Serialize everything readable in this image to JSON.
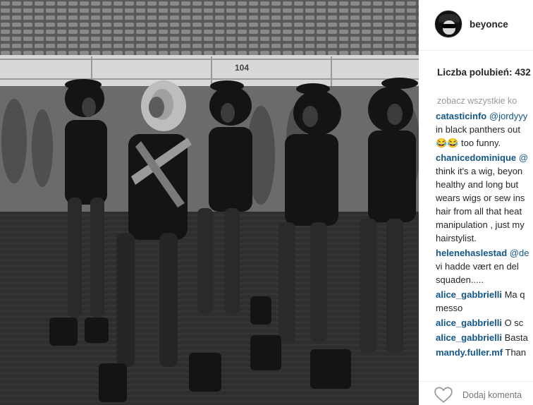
{
  "post": {
    "username": "beyonce",
    "likes_label": "Liczba polubień: 432",
    "see_all_label": "zobacz wszystkie ko",
    "add_comment_placeholder": "Dodaj komenta"
  },
  "photo": {
    "section_sign": "104"
  },
  "comments": [
    {
      "user": "catasticinfo",
      "lines": [
        "@jordyyy",
        "in black panthers out",
        "😂😂 too funny."
      ]
    },
    {
      "user": "chanicedominique",
      "lines": [
        "@",
        "think it's a wig, beyon",
        "healthy and long but",
        "wears wigs or sew ins",
        "hair from all that heat",
        "manipulation , just my",
        "hairstylist."
      ]
    },
    {
      "user": "helenehaslestad",
      "lines": [
        "@de",
        "vi hadde vært en del",
        "squaden....."
      ]
    },
    {
      "user": "alice_gabbrielli",
      "lines": [
        "Ma q",
        "messo"
      ]
    },
    {
      "user": "alice_gabbrielli",
      "lines": [
        "O sc"
      ]
    },
    {
      "user": "alice_gabbrielli",
      "lines": [
        "Basta"
      ]
    },
    {
      "user": "mandy.fuller.mf",
      "lines": [
        "Than"
      ]
    }
  ],
  "colors": {
    "username_link": "#125688",
    "muted_text": "#999999",
    "divider": "#efefef"
  },
  "icons": [
    "avatar",
    "heart-icon"
  ]
}
